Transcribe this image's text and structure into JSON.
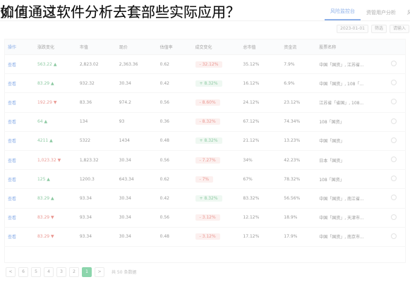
{
  "overlay": {
    "line_primary": "如何通过软件分析去套部些实际应用？",
    "line_secondary": "价值通这软件分析去套部些实际应用？"
  },
  "tabs": [
    "风险监控台",
    "资管用户分析",
    "风险指标"
  ],
  "toolbar": {
    "search_placeholder": "请输入",
    "filter_label": "筛选",
    "date_label": "2023-01-01"
  },
  "table": {
    "headers": [
      "操作",
      "涨跌变化",
      "市值",
      "现价",
      "估值率",
      "成交变化",
      "总市值",
      "资金流",
      "股票名称",
      ""
    ],
    "rows": [
      {
        "op": "查看",
        "chg": "563.22 ▲",
        "chg_dir": "up",
        "a": "2,823.02",
        "b": "2,363.36",
        "c": "0.62",
        "pill": "- 32.12%",
        "pill_dir": "down",
        "d": "35.12%",
        "e": "7.9%",
        "name": "中国「国资」, 江苏省..."
      },
      {
        "op": "查看",
        "chg": "83.29 ▲",
        "chg_dir": "up",
        "a": "932.32",
        "b": "30.34",
        "c": "0.42",
        "pill": "+ 8.32%",
        "pill_dir": "up",
        "d": "16.12%",
        "e": "6.9%",
        "name": "中国「国资」, 108「..."
      },
      {
        "op": "查看",
        "chg": "192.29 ▼",
        "chg_dir": "down",
        "a": "83.36",
        "b": "974.2",
        "c": "0.56",
        "pill": "- 8.60%",
        "pill_dir": "down",
        "d": "24.12%",
        "e": "23.12%",
        "name": "江苏省「省国」, 108..."
      },
      {
        "op": "查看",
        "chg": "64 ▲",
        "chg_dir": "up",
        "a": "134",
        "b": "93",
        "c": "0.36",
        "pill": "- 8.32%",
        "pill_dir": "down",
        "d": "67.12%",
        "e": "74.34%",
        "name": "108「国资」"
      },
      {
        "op": "查看",
        "chg": "4211 ▲",
        "chg_dir": "up",
        "a": "5322",
        "b": "1434",
        "c": "0.48",
        "pill": "+ 8.32%",
        "pill_dir": "up",
        "d": "21.12%",
        "e": "13.23%",
        "name": "中国「国资」"
      },
      {
        "op": "查看",
        "chg": "1,023.32 ▼",
        "chg_dir": "down",
        "a": "1,823.32",
        "b": "30.34",
        "c": "0.56",
        "pill": "- 7.27%",
        "pill_dir": "down",
        "d": "34%",
        "e": "42.23%",
        "name": "日本「国资」"
      },
      {
        "op": "查看",
        "chg": "125 ▲",
        "chg_dir": "up",
        "a": "1200.3",
        "b": "643.34",
        "c": "0.62",
        "pill": "- 7%",
        "pill_dir": "down",
        "d": "67%",
        "e": "78.32%",
        "name": "108「国资」"
      },
      {
        "op": "查看",
        "chg": "83.29 ▲",
        "chg_dir": "up",
        "a": "93.34",
        "b": "30.34",
        "c": "0.42",
        "pill": "+ 8.32%",
        "pill_dir": "up",
        "d": "83.32%",
        "e": "56.56%",
        "name": "中国「国资」, 南江省..."
      },
      {
        "op": "查看",
        "chg": "83.29 ▼",
        "chg_dir": "down",
        "a": "93.34",
        "b": "30.34",
        "c": "0.56",
        "pill": "- 3.12%",
        "pill_dir": "down",
        "d": "12.12%",
        "e": "18.9%",
        "name": "中国「国资」, 天津市..."
      },
      {
        "op": "查看",
        "chg": "83.29 ▼",
        "chg_dir": "down",
        "a": "93.34",
        "b": "30.34",
        "c": "0.48",
        "pill": "- 3.12%",
        "pill_dir": "down",
        "d": "17.12%",
        "e": "17.9%",
        "name": "中国「国资」, 南京市..."
      }
    ]
  },
  "pager": {
    "pages": [
      "<",
      "6",
      "5",
      "4",
      "3",
      "2",
      "1",
      ">"
    ],
    "active": "1",
    "total_text": "共 50 条数据"
  },
  "colors": {
    "accent": "#2f6fd6",
    "up": "#2e9d55",
    "down": "#d9443a",
    "page_active": "#2fb36a"
  }
}
